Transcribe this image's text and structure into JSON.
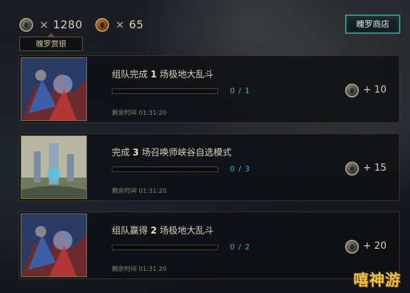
{
  "currency": {
    "silver_symbol": "×",
    "silver_amount": "1280",
    "gold_symbol": "×",
    "gold_amount": "65",
    "silver_icon": "silver-coin-icon",
    "gold_icon": "gold-coin-icon"
  },
  "bounty_tag": "魄罗赏银",
  "store_button": "魄罗商店",
  "missions": [
    {
      "title_prefix": "组队完成",
      "title_count": "1",
      "title_suffix": "场极地大乱斗",
      "progress_current": "0",
      "progress_total": "1",
      "progress_fraction": 0,
      "timer_label": "剩余时间",
      "timer_value": "01:31:20",
      "reward": "+ 10",
      "thumb": "aram-art"
    },
    {
      "title_prefix": "完成",
      "title_count": "3",
      "title_suffix": "场召唤师峡谷自选模式",
      "progress_current": "0",
      "progress_total": "3",
      "progress_fraction": 0,
      "timer_label": "剩余时间",
      "timer_value": "01:31:20",
      "reward": "+ 15",
      "thumb": "summoners-rift-art"
    },
    {
      "title_prefix": "组队赢得",
      "title_count": "2",
      "title_suffix": "场极地大乱斗",
      "progress_current": "0",
      "progress_total": "2",
      "progress_fraction": 0,
      "timer_label": "剩余时间",
      "timer_value": "01:31:20",
      "reward": "+ 20",
      "thumb": "aram-art"
    }
  ],
  "watermark": "嘻神游",
  "colors": {
    "accent_teal": "#3b8f8a",
    "progress_blue": "#4fa8c4",
    "card_border_gold": "#8a7440"
  }
}
